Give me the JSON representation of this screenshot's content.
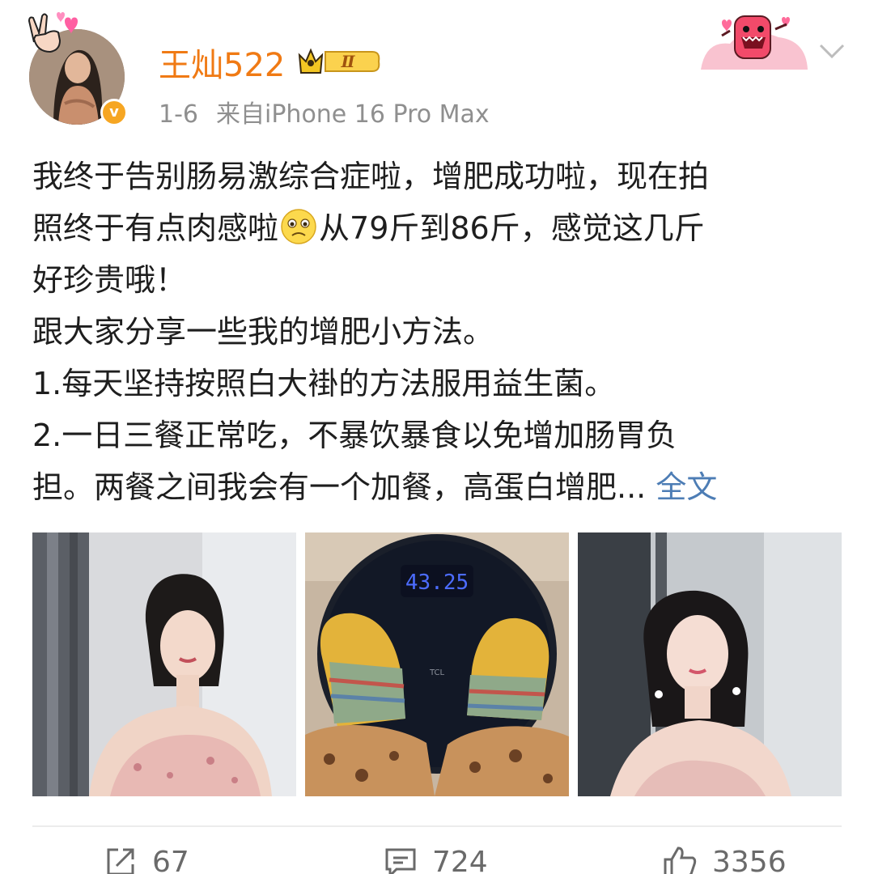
{
  "header": {
    "username": "王灿522",
    "level_badge": "Ⅱ",
    "time": "1-6",
    "source": "来自iPhone 16 Pro Max",
    "verified_mark": "v",
    "icons": [
      "hand-sticker-icon",
      "crown-level-icon",
      "domo-sticker-icon",
      "chevron-down-icon"
    ]
  },
  "post": {
    "lines": [
      "我终于告别肠易激综合症啦，增肥成功啦，现在拍",
      "照终于有点肉感啦",
      "从79斤到86斤，感觉这几斤",
      "好珍贵哦！",
      "跟大家分享一些我的增肥小方法。",
      "1.每天坚持按照白大褂的方法服用益生菌。",
      "2.一日三餐正常吃，不暴饮暴食以免增加肠胃负",
      "担。两餐之间我会有一个加餐，高蛋白增肥... "
    ],
    "full_text_link": "全文"
  },
  "photos": {
    "scale_reading": "43.25",
    "scale_brand": "TCL"
  },
  "actions": {
    "repost_count": "67",
    "comment_count": "724",
    "like_count": "3356"
  },
  "colors": {
    "username": "#f07a14",
    "link": "#4d7db5",
    "meta": "#8f8f8f",
    "verified": "#f6a623"
  }
}
